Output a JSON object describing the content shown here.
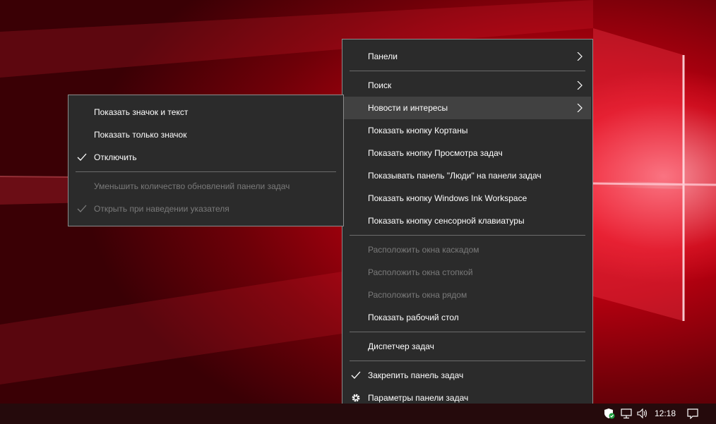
{
  "main_menu": {
    "items": [
      {
        "label": "Панели"
      },
      {
        "label": "Поиск"
      },
      {
        "label": "Новости и интересы"
      },
      {
        "label": "Показать кнопку Кортаны"
      },
      {
        "label": "Показать кнопку Просмотра задач"
      },
      {
        "label": "Показывать панель \"Люди\" на панели задач"
      },
      {
        "label": "Показать кнопку Windows Ink Workspace"
      },
      {
        "label": "Показать кнопку сенсорной клавиатуры"
      },
      {
        "label": "Расположить окна каскадом"
      },
      {
        "label": "Расположить окна стопкой"
      },
      {
        "label": "Расположить окна рядом"
      },
      {
        "label": "Показать рабочий стол"
      },
      {
        "label": "Диспетчер задач"
      },
      {
        "label": "Закрепить панель задач"
      },
      {
        "label": "Параметры панели задач"
      }
    ]
  },
  "sub_menu": {
    "items": [
      {
        "label": "Показать значок и текст"
      },
      {
        "label": "Показать только значок"
      },
      {
        "label": "Отключить"
      },
      {
        "label": "Уменьшить количество обновлений панели задач"
      },
      {
        "label": "Открыть при наведении указателя"
      }
    ]
  },
  "taskbar": {
    "clock": "12:18",
    "tray_icons": [
      "windows-security-icon",
      "network-icon",
      "volume-icon",
      "action-center-icon"
    ]
  },
  "colors": {
    "menu_bg": "#2b2b2b",
    "menu_hover": "#414141",
    "menu_border": "#8c8c8c",
    "text": "#ffffff",
    "text_disabled": "#7a7a7a",
    "accent_wallpaper": "#c8001a",
    "taskbar_bg": "#250a0c"
  }
}
